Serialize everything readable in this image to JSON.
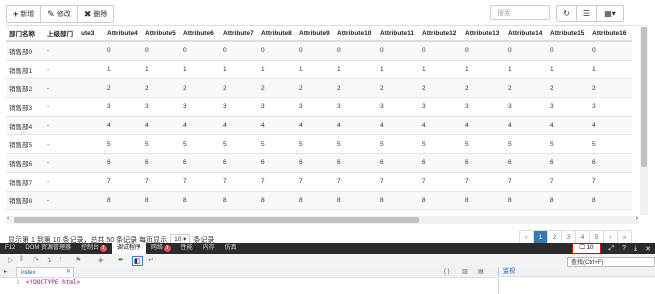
{
  "toolbar": {
    "add_label": "新增",
    "edit_label": "修改",
    "delete_label": "删除",
    "search_placeholder": "搜索"
  },
  "table": {
    "columns": [
      "部门名称",
      "上级部门",
      "ute3",
      "Attribute4",
      "Attribute5",
      "Attribute6",
      "Attribute7",
      "Attribute8",
      "Attribute9",
      "Attribute10",
      "Attribute11",
      "Attribute12",
      "Attribute13",
      "Attribute14",
      "Attribute15",
      "Attribute16"
    ],
    "rows": [
      [
        "销售部0",
        "-",
        "",
        "0",
        "0",
        "0",
        "0",
        "0",
        "0",
        "0",
        "0",
        "0",
        "0",
        "0",
        "0",
        "0"
      ],
      [
        "销售部1",
        "-",
        "",
        "1",
        "1",
        "1",
        "1",
        "1",
        "1",
        "1",
        "1",
        "1",
        "1",
        "1",
        "1",
        "1"
      ],
      [
        "销售部2",
        "-",
        "",
        "2",
        "2",
        "2",
        "2",
        "2",
        "2",
        "2",
        "2",
        "2",
        "2",
        "2",
        "2",
        "2"
      ],
      [
        "销售部3",
        "-",
        "",
        "3",
        "3",
        "3",
        "3",
        "3",
        "3",
        "3",
        "3",
        "3",
        "3",
        "3",
        "3",
        "3"
      ],
      [
        "销售部4",
        "-",
        "",
        "4",
        "4",
        "4",
        "4",
        "4",
        "4",
        "4",
        "4",
        "4",
        "4",
        "4",
        "4",
        "4"
      ],
      [
        "销售部5",
        "-",
        "",
        "5",
        "5",
        "5",
        "5",
        "5",
        "5",
        "5",
        "5",
        "5",
        "5",
        "5",
        "5",
        "5"
      ],
      [
        "销售部6",
        "-",
        "",
        "6",
        "6",
        "6",
        "6",
        "6",
        "6",
        "6",
        "6",
        "6",
        "6",
        "6",
        "6",
        "6"
      ],
      [
        "销售部7",
        "-",
        "",
        "7",
        "7",
        "7",
        "7",
        "7",
        "7",
        "7",
        "7",
        "7",
        "7",
        "7",
        "7",
        "7"
      ],
      [
        "销售部8",
        "-",
        "",
        "8",
        "8",
        "8",
        "8",
        "8",
        "8",
        "8",
        "8",
        "8",
        "8",
        "8",
        "8",
        "8"
      ],
      [
        "销售部9",
        "-",
        "",
        "9",
        "9",
        "9",
        "9",
        "9",
        "9",
        "9",
        "9",
        "9",
        "9",
        "9",
        "9",
        "9"
      ]
    ]
  },
  "footer": {
    "info_pre": "显示第 1 到第 10 条记录，总共 50 条记录 每页显示",
    "page_size": "10",
    "info_post": "条记录",
    "pages": [
      "‹",
      "1",
      "2",
      "3",
      "4",
      "5",
      "›",
      "»"
    ],
    "active_page": "1"
  },
  "devtools": {
    "tabs": [
      {
        "label": "F12"
      },
      {
        "label": "DOM 资源管理器"
      },
      {
        "label": "控制台",
        "badge": "1"
      },
      {
        "label": "调试程序",
        "selected": true
      },
      {
        "label": "网络",
        "badge": "1"
      },
      {
        "label": "性能"
      },
      {
        "label": "内存"
      },
      {
        "label": "仿真"
      }
    ],
    "zoom": "10",
    "tip": "查找(Ctrl+F)",
    "source_tab": "index",
    "side_tab": "监视",
    "line_no": "1",
    "code": "<!DOCTYPE html>"
  }
}
